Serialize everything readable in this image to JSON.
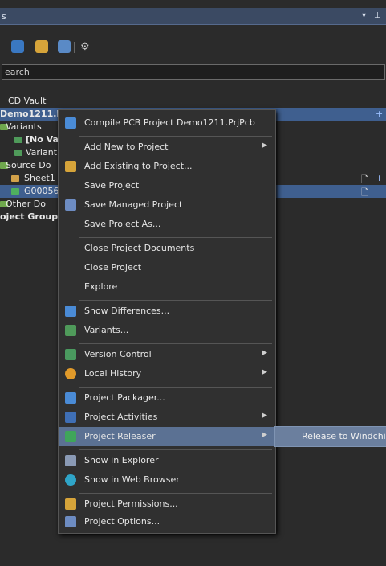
{
  "panel": {
    "title": "s",
    "pin_icon": "pin-icon",
    "dropdown_icon": "chevron-down-icon"
  },
  "search": {
    "value": "earch"
  },
  "tree": {
    "items": [
      {
        "label": "CD Vault"
      },
      {
        "label": "Demo1211.I"
      },
      {
        "label": "Variants"
      },
      {
        "label": "[No Va"
      },
      {
        "label": "Variant"
      },
      {
        "label": "Source Do"
      },
      {
        "label": "Sheet1"
      },
      {
        "label": "G00056"
      },
      {
        "label": "Other Do"
      },
      {
        "label": "oject Group"
      }
    ],
    "plus": "+",
    "doc_icon": "document-icon"
  },
  "menu": {
    "items": [
      {
        "label": "Compile PCB Project Demo1211.PrjPcb",
        "icon": "compile-icon"
      },
      {
        "label": "Add New to Project",
        "submenu": true
      },
      {
        "label": "Add Existing to Project...",
        "icon": "add-existing-icon"
      },
      {
        "label": "Save Project"
      },
      {
        "label": "Save Managed Project",
        "icon": "save-managed-icon"
      },
      {
        "label": "Save Project As..."
      },
      {
        "label": "Close Project Documents"
      },
      {
        "label": "Close Project"
      },
      {
        "label": "Explore"
      },
      {
        "label": "Show Differences...",
        "icon": "differences-icon"
      },
      {
        "label": "Variants...",
        "icon": "variants-icon"
      },
      {
        "label": "Version Control",
        "icon": "version-control-icon",
        "submenu": true
      },
      {
        "label": "Local History",
        "icon": "history-icon",
        "submenu": true
      },
      {
        "label": "Project Packager...",
        "icon": "packager-icon"
      },
      {
        "label": "Project Activities",
        "icon": "activities-icon",
        "submenu": true
      },
      {
        "label": "Project Releaser",
        "icon": "releaser-icon",
        "submenu": true
      },
      {
        "label": "Show in Explorer",
        "icon": "explorer-icon"
      },
      {
        "label": "Show in Web Browser",
        "icon": "globe-icon"
      },
      {
        "label": "Project Permissions...",
        "icon": "permissions-icon"
      },
      {
        "label": "Project Options...",
        "icon": "options-icon"
      }
    ]
  },
  "submenu": {
    "label": "Release to Windchil"
  },
  "colors": {
    "highlight": "#5b7193",
    "panel_header": "#3b4a63",
    "selected_row": "#3f5f8f"
  }
}
